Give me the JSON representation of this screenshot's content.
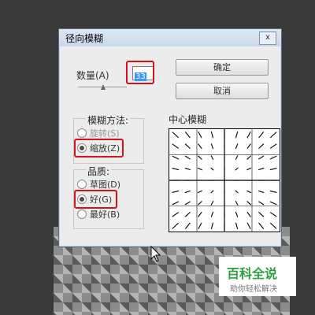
{
  "dialog": {
    "title": "径向模糊",
    "close_glyph": "x",
    "amount_label": "数量(A)",
    "amount_value": "33",
    "ok_button": "确定",
    "cancel_button": "取消",
    "blur_method": {
      "label": "模糊方法:",
      "options": [
        {
          "label": "旋转(S)",
          "selected": false
        },
        {
          "label": "缩放(Z)",
          "selected": true
        }
      ]
    },
    "quality": {
      "label": "品质:",
      "options": [
        {
          "label": "草图(D)",
          "selected": false
        },
        {
          "label": "好(G)",
          "selected": true
        },
        {
          "label": "最好(B)",
          "selected": false
        }
      ]
    },
    "center_label": "中心模糊"
  },
  "watermark": {
    "title": "百科全说",
    "subtitle": "助你轻松解决"
  },
  "colors": {
    "highlight": "#d0141e",
    "selection": "#3399ff",
    "brand": "#2e9e3a"
  }
}
